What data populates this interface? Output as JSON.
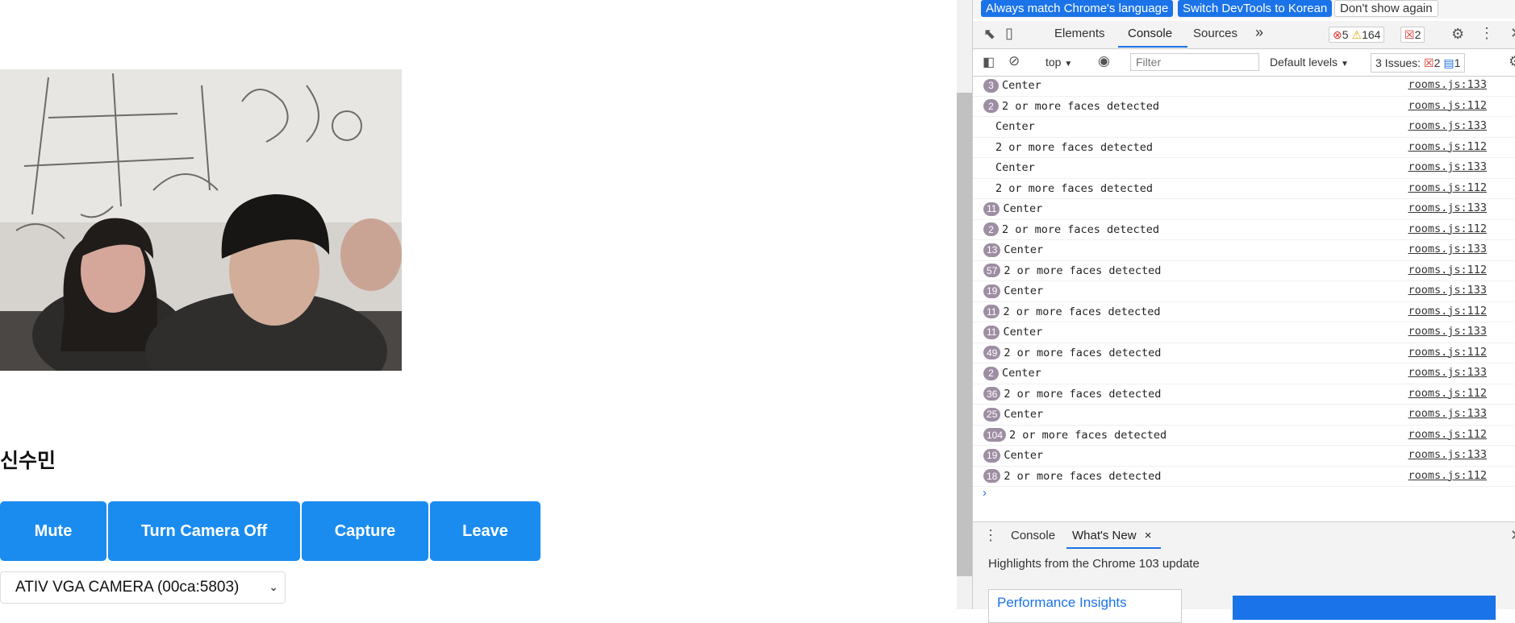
{
  "page": {
    "username": "신수민",
    "buttons": {
      "mute": "Mute",
      "camera": "Turn Camera Off",
      "capture": "Capture",
      "leave": "Leave"
    },
    "camera_select": "ATIV VGA CAMERA (00ca:5803)"
  },
  "devtools": {
    "lang_bar": {
      "always": "Always match Chrome's language",
      "switch": "Switch DevTools to Korean",
      "dont_show": "Don't show again"
    },
    "tabs": {
      "elements": "Elements",
      "console": "Console",
      "sources": "Sources",
      "more": "»"
    },
    "counters": {
      "errors": "5",
      "warnings": "164",
      "issues": "2"
    },
    "filter_bar": {
      "context": "top",
      "filter_placeholder": "Filter",
      "levels": "Default levels",
      "issues_label": "3 Issues:",
      "issues_err": "2",
      "issues_info": "1"
    },
    "messages": [
      {
        "count": "3",
        "text": "Center",
        "source": "rooms.js:133"
      },
      {
        "count": "2",
        "text": "2 or more faces detected",
        "source": "rooms.js:112"
      },
      {
        "count": "",
        "text": "Center",
        "source": "rooms.js:133"
      },
      {
        "count": "",
        "text": "2 or more faces detected",
        "source": "rooms.js:112"
      },
      {
        "count": "",
        "text": "Center",
        "source": "rooms.js:133"
      },
      {
        "count": "",
        "text": "2 or more faces detected",
        "source": "rooms.js:112"
      },
      {
        "count": "11",
        "text": "Center",
        "source": "rooms.js:133"
      },
      {
        "count": "2",
        "text": "2 or more faces detected",
        "source": "rooms.js:112"
      },
      {
        "count": "13",
        "text": "Center",
        "source": "rooms.js:133"
      },
      {
        "count": "57",
        "text": "2 or more faces detected",
        "source": "rooms.js:112"
      },
      {
        "count": "19",
        "text": "Center",
        "source": "rooms.js:133"
      },
      {
        "count": "11",
        "text": "2 or more faces detected",
        "source": "rooms.js:112"
      },
      {
        "count": "11",
        "text": "Center",
        "source": "rooms.js:133"
      },
      {
        "count": "49",
        "text": "2 or more faces detected",
        "source": "rooms.js:112"
      },
      {
        "count": "2",
        "text": "Center",
        "source": "rooms.js:133"
      },
      {
        "count": "36",
        "text": "2 or more faces detected",
        "source": "rooms.js:112"
      },
      {
        "count": "25",
        "text": "Center",
        "source": "rooms.js:133"
      },
      {
        "count": "104",
        "text": "2 or more faces detected",
        "source": "rooms.js:112"
      },
      {
        "count": "19",
        "text": "Center",
        "source": "rooms.js:133"
      },
      {
        "count": "18",
        "text": "2 or more faces detected",
        "source": "rooms.js:112"
      }
    ],
    "prompt": "›",
    "drawer": {
      "console_tab": "Console",
      "whats_new_tab": "What's New",
      "close": "×",
      "highlights": "Highlights from the Chrome 103 update",
      "card_title": "Performance Insights"
    },
    "colors": {
      "accent": "#1a73e8",
      "button_blue": "#1a8cf0",
      "badge": "#9e8ea3"
    }
  }
}
